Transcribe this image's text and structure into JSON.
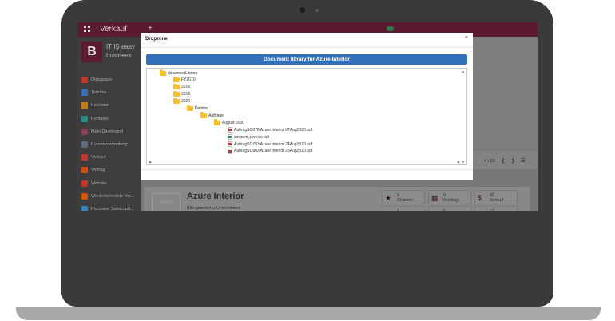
{
  "topbar": {
    "app_title": "Verkauf",
    "plus": "+"
  },
  "sidebar": {
    "brand_letter": "B",
    "brand_line1": "IT IS easy",
    "brand_line2": "business",
    "items": [
      {
        "label": "Diskussion",
        "color": "#c0392b"
      },
      {
        "label": "Termine",
        "color": "#3b6db5"
      },
      {
        "label": "Kalender",
        "color": "#c47a1e"
      },
      {
        "label": "Kontakte",
        "color": "#1f8f8f"
      },
      {
        "label": "Mein Dashboard",
        "color": "#8e3b5c"
      },
      {
        "label": "Kundenverwaltung",
        "color": "#5d6d7e"
      },
      {
        "label": "Verkauf",
        "color": "#c0392b"
      },
      {
        "label": "Vertrag",
        "color": "#d35400"
      },
      {
        "label": "Website",
        "color": "#c0392b"
      },
      {
        "label": "Wiederkehrende Ver...",
        "color": "#d35400"
      },
      {
        "label": "Purchase Subscripti...",
        "color": "#2e86c1"
      }
    ]
  },
  "pager": {
    "text": "4 / 68"
  },
  "form": {
    "logo_text": "azure",
    "company": "Azure Interior",
    "parent_label": "Übergeordnetes Unternehmen",
    "stats": [
      {
        "icon": "★",
        "value": "0",
        "label": "Chancen"
      },
      {
        "icon": "▦",
        "value": "0",
        "label": "Meetings"
      },
      {
        "icon": "$",
        "value": "92",
        "label": "Verkauf"
      },
      {
        "icon": "▲",
        "value": "1",
        "label": ""
      },
      {
        "icon": "▬",
        "value": "0",
        "label": ""
      },
      {
        "icon": "▬",
        "value": "17",
        "label": ""
      }
    ]
  },
  "modal": {
    "title": "Dropzone",
    "close": "×",
    "library_button": "Document library for Azure Interior",
    "tree": [
      {
        "type": "folder",
        "label": "documentLibrary",
        "depth": 0
      },
      {
        "type": "folder",
        "label": "FY2010",
        "depth": 1
      },
      {
        "type": "folder",
        "label": "2019",
        "depth": 1
      },
      {
        "type": "folder",
        "label": "2018",
        "depth": 1
      },
      {
        "type": "folder",
        "label": "2020",
        "depth": 1
      },
      {
        "type": "folder",
        "label": "Debitor",
        "depth": 2
      },
      {
        "type": "folder",
        "label": "Aufträge",
        "depth": 3
      },
      {
        "type": "folder",
        "label": "August 2020",
        "depth": 4
      },
      {
        "type": "pdf",
        "label": "AuftragSO078 Azure Interior 07Aug2020.pdf",
        "depth": 5
      },
      {
        "type": "odt",
        "label": "account_invoice.odt",
        "depth": 5
      },
      {
        "type": "pdf",
        "label": "AuftragSO793 Azure Interior 24Aug2020.pdf",
        "depth": 5
      },
      {
        "type": "pdf",
        "label": "AuftragSO803 Azure Interior 25Aug2020.pdf",
        "depth": 5
      }
    ]
  }
}
